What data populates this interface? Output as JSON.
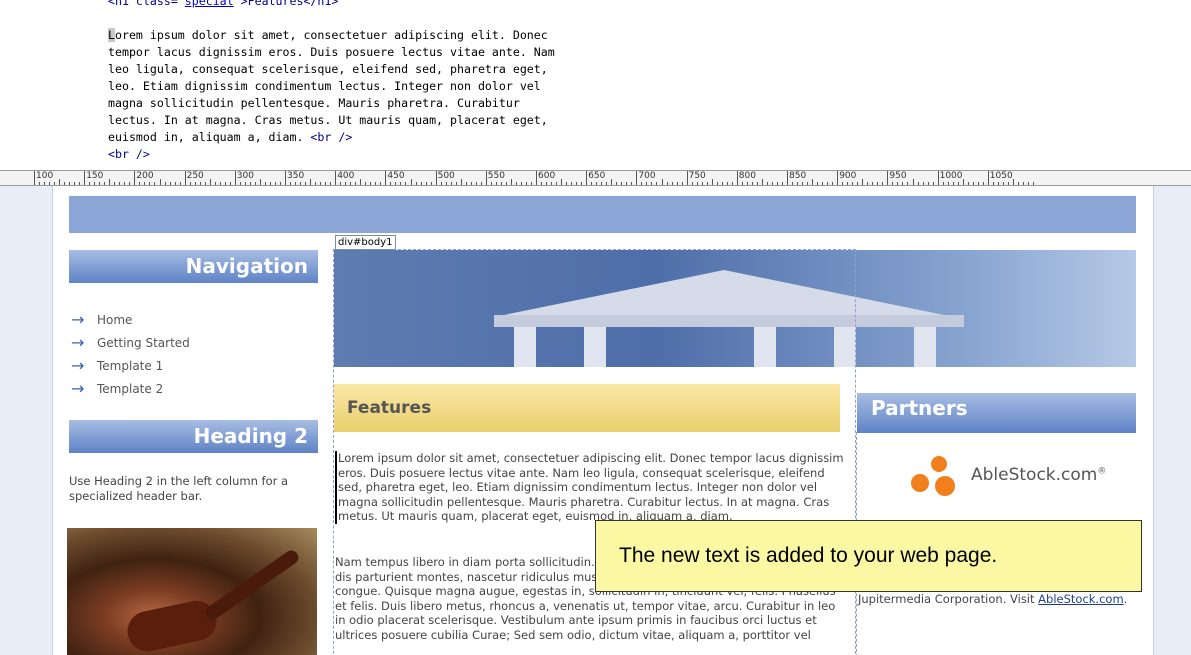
{
  "code": {
    "line1_tag_open": "<h1 class=\"",
    "line1_class": "special",
    "line1_tag_close": "\">Features</h1>",
    "para_lines": [
      "Lorem ipsum dolor sit amet, consectetuer adipiscing elit. Donec",
      "tempor lacus dignissim eros. Duis posuere lectus vitae ante. Nam",
      "leo ligula, consequat scelerisque, eleifend sed, pharetra eget,",
      "leo. Etiam dignissim condimentum lectus. Integer non dolor vel",
      "magna sollicitudin pellentesque. Mauris pharetra. Curabitur",
      "lectus. In at magna. Cras metus. Ut mauris quam, placerat eget,"
    ],
    "last_line_text": "euismod in, aliquam a, diam. ",
    "br_tag": "<br />",
    "next_line": "<br />"
  },
  "ruler": {
    "labels": [
      "100",
      "150",
      "200",
      "250",
      "300",
      "350",
      "400",
      "450",
      "500",
      "550",
      "600",
      "650",
      "700",
      "750",
      "800",
      "850",
      "900",
      "950",
      "1000",
      "1050"
    ]
  },
  "nav": {
    "heading": "Navigation",
    "items": [
      "Home",
      "Getting Started",
      "Template 1",
      "Template 2"
    ]
  },
  "heading2": {
    "title": "Heading 2",
    "text": "Use Heading 2 in the left column for a specialized header bar."
  },
  "body1": {
    "label": "div#body1",
    "features_title": "Features",
    "para1": "Lorem ipsum dolor sit amet, consectetuer adipiscing elit. Donec tempor lacus dignissim eros. Duis posuere lectus vitae ante. Nam leo ligula, consequat scelerisque, eleifend sed, pharetra eget, leo. Etiam dignissim condimentum lectus. Integer non dolor vel magna sollicitudin pellentesque. Mauris pharetra. Curabitur lectus. In at magna. Cras metus. Ut mauris quam, placerat eget, euismod in, aliquam a, diam.",
    "para2": "Nam tempus libero in diam porta sollicitudin. Cum sociis natoque penatibus et magnis dis parturient montes, nascetur ridiculus mus. Sed porttitor libero non libero. Curabitur congue. Quisque magna augue, egestas in, sollicitudin in, tincidunt vel, felis. Phasellus et felis. Duis libero metus, rhoncus a, venenatis ut, tempor vitae, arcu. Curabitur in leo in odio placerat scelerisque. Vestibulum ante ipsum primis in faucibus orci luctus et ultrices posuere cubilia Curae; Sed sem odio, dictum vitae, aliquam a, porttitor vel"
  },
  "partners": {
    "heading": "Partners",
    "logo_text": "AbleStock.com",
    "logo_mark": "®",
    "text": "AbleStock.com is the image download hub for professionals, giving you nothing but the best in high-resolution, royalty-free images. AbleStock.com is a trademark of JupiterImages Corporation, a wholly-owned subsidiary of Jupitermedia Corporation. Visit ",
    "link": "AbleStock.com",
    "link_suffix": "."
  },
  "callout": {
    "text": "The new text is added to your web page."
  },
  "colors": {
    "nav_header": "#5f83c6",
    "features_header": "#e8cf6e",
    "callout_bg": "#fbf8a3",
    "banner": "#8aa5d6"
  }
}
